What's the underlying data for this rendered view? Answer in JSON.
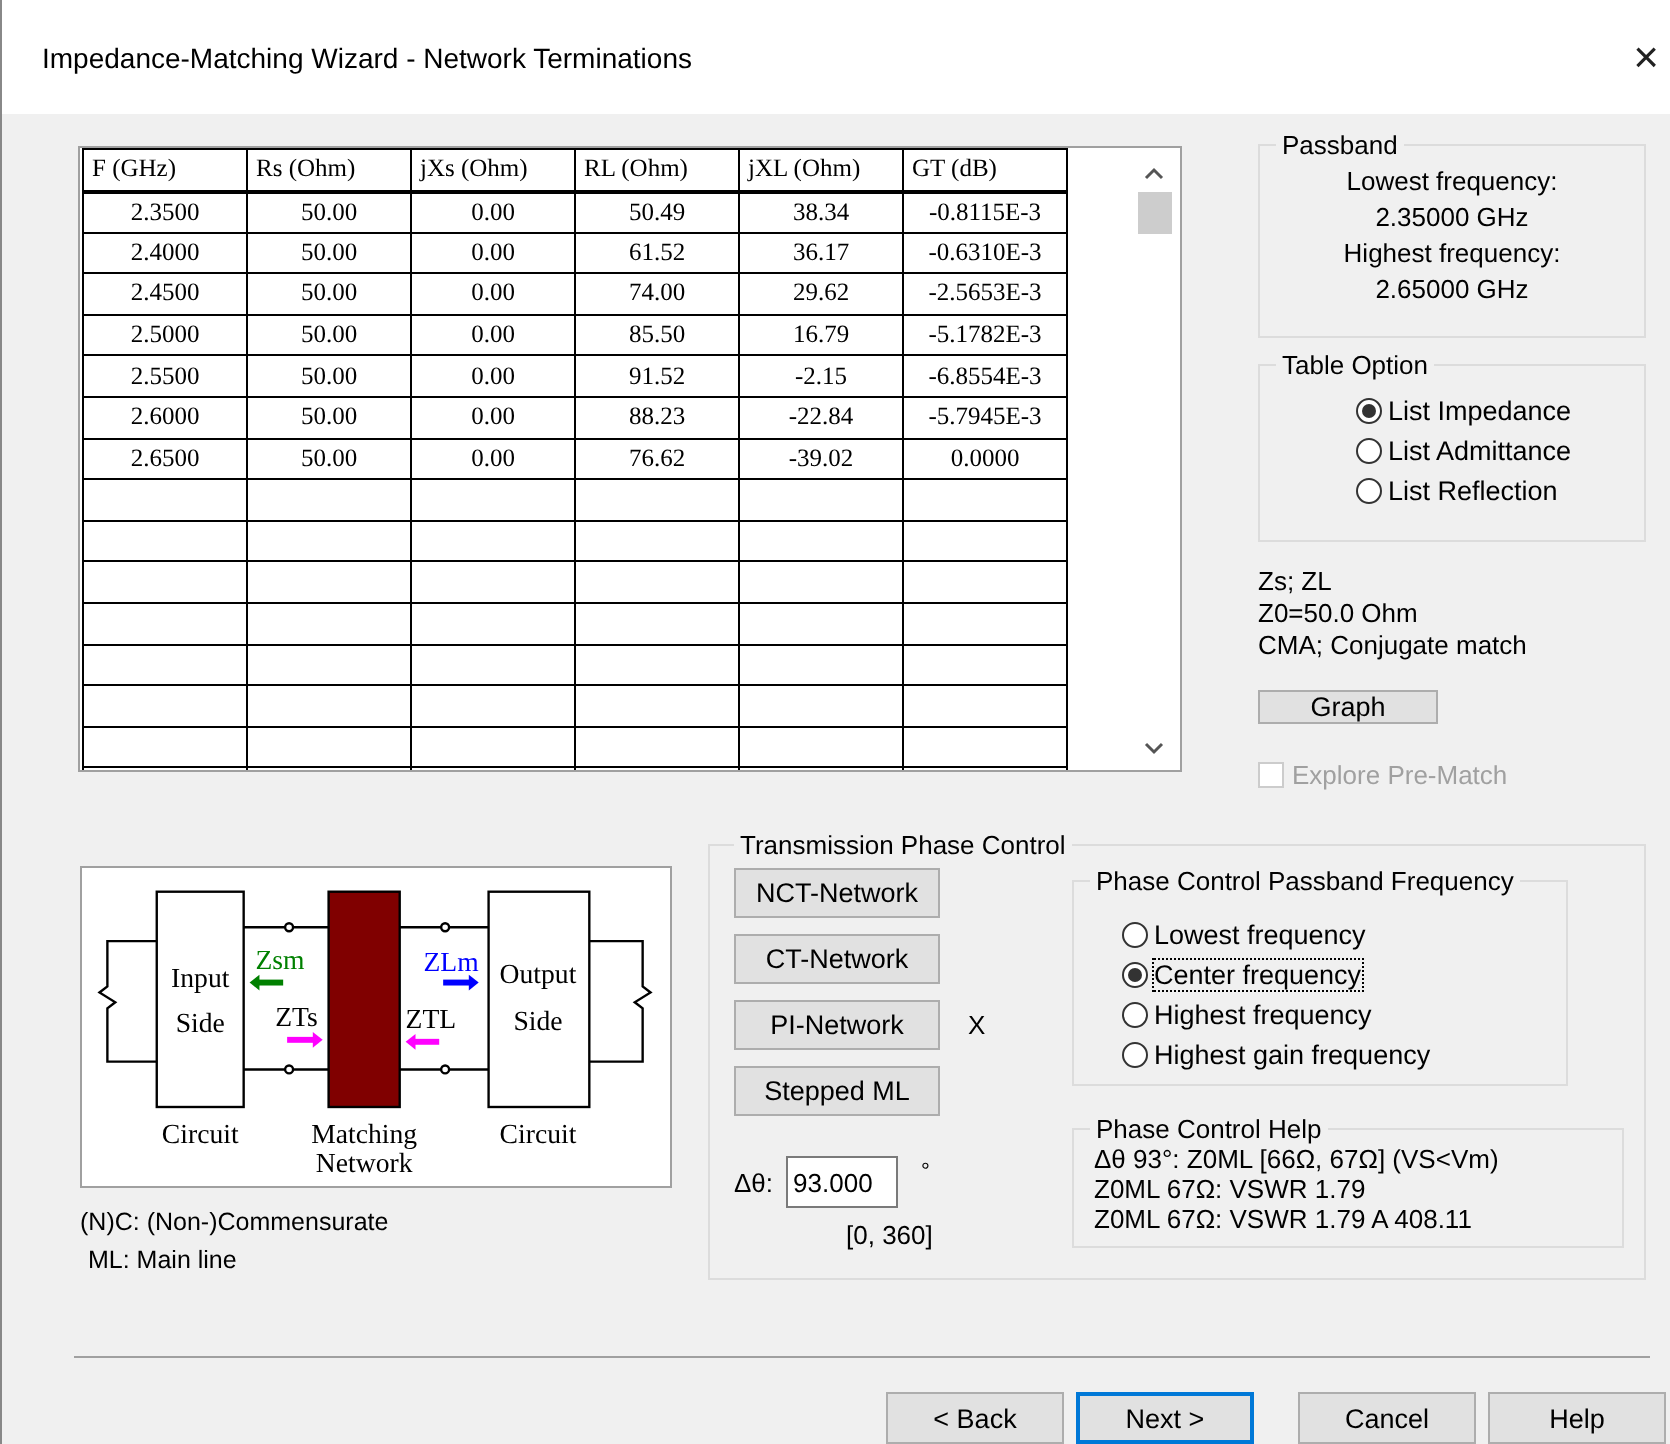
{
  "window": {
    "title": "Impedance-Matching Wizard - Network Terminations",
    "close": "×"
  },
  "table": {
    "columns": [
      "F (GHz)",
      "Rs (Ohm)",
      "jXs (Ohm)",
      "RL (Ohm)",
      "jXL (Ohm)",
      "GT (dB)"
    ],
    "rows": [
      [
        "2.3500",
        "50.00",
        "0.00",
        "50.49",
        "38.34",
        "-0.8115E-3"
      ],
      [
        "2.4000",
        "50.00",
        "0.00",
        "61.52",
        "36.17",
        "-0.6310E-3"
      ],
      [
        "2.4500",
        "50.00",
        "0.00",
        "74.00",
        "29.62",
        "-2.5653E-3"
      ],
      [
        "2.5000",
        "50.00",
        "0.00",
        "85.50",
        "16.79",
        "-5.1782E-3"
      ],
      [
        "2.5500",
        "50.00",
        "0.00",
        "91.52",
        "-2.15",
        "-6.8554E-3"
      ],
      [
        "2.6000",
        "50.00",
        "0.00",
        "88.23",
        "-22.84",
        "-5.7945E-3"
      ],
      [
        "2.6500",
        "50.00",
        "0.00",
        "76.62",
        "-39.02",
        "0.0000"
      ]
    ]
  },
  "passband": {
    "title": "Passband",
    "lines": [
      "Lowest frequency:",
      "2.35000 GHz",
      "Highest frequency:",
      "2.65000 GHz"
    ]
  },
  "table_option": {
    "title": "Table Option",
    "options": [
      {
        "label": "List Impedance",
        "selected": true
      },
      {
        "label": "List Admittance",
        "selected": false
      },
      {
        "label": "List Reflection",
        "selected": false
      }
    ]
  },
  "info_lines": [
    "Zs; ZL",
    "Z0=50.0 Ohm",
    "CMA; Conjugate match"
  ],
  "graph_button": "Graph",
  "explore_prematch": {
    "label": "Explore Pre-Match",
    "checked": false,
    "disabled": true
  },
  "diagram": {
    "input": [
      "Input",
      "Side"
    ],
    "input_caption": "Circuit",
    "network": [
      "Matching",
      "Network"
    ],
    "output": [
      "Output",
      "Side"
    ],
    "output_caption": "Circuit",
    "zsm": "Zsm",
    "zts": "ZTs",
    "zlm": "ZLm",
    "ztl": "ZTL"
  },
  "notes": [
    "(N)C: (Non-)Commensurate",
    "ML: Main line"
  ],
  "phase_control": {
    "title": "Transmission Phase Control",
    "buttons": [
      {
        "label": "NCT-Network"
      },
      {
        "label": "CT-Network"
      },
      {
        "label": "PI-Network",
        "mark": "X"
      },
      {
        "label": "Stepped ML"
      }
    ],
    "delta_label": "Δθ:",
    "delta_value": "93.000",
    "unit": "°",
    "range": "[0, 360]",
    "frequency": {
      "title": "Phase Control Passband Frequency",
      "options": [
        {
          "label": "Lowest frequency",
          "selected": false
        },
        {
          "label": "Center frequency",
          "selected": true
        },
        {
          "label": "Highest frequency",
          "selected": false
        },
        {
          "label": "Highest gain frequency",
          "selected": false
        }
      ]
    },
    "help": {
      "title": "Phase Control Help",
      "lines": [
        "Δθ 93°: Z0ML [66Ω, 67Ω] (VS<Vm)",
        "Z0ML 67Ω: VSWR 1.79",
        "Z0ML 67Ω: VSWR 1.79 A 408.11"
      ]
    }
  },
  "buttons": [
    {
      "label": "< Back",
      "default": false
    },
    {
      "label": "Next >",
      "default": true
    },
    {
      "label": "Cancel",
      "default": false
    },
    {
      "label": "Help",
      "default": false
    }
  ]
}
